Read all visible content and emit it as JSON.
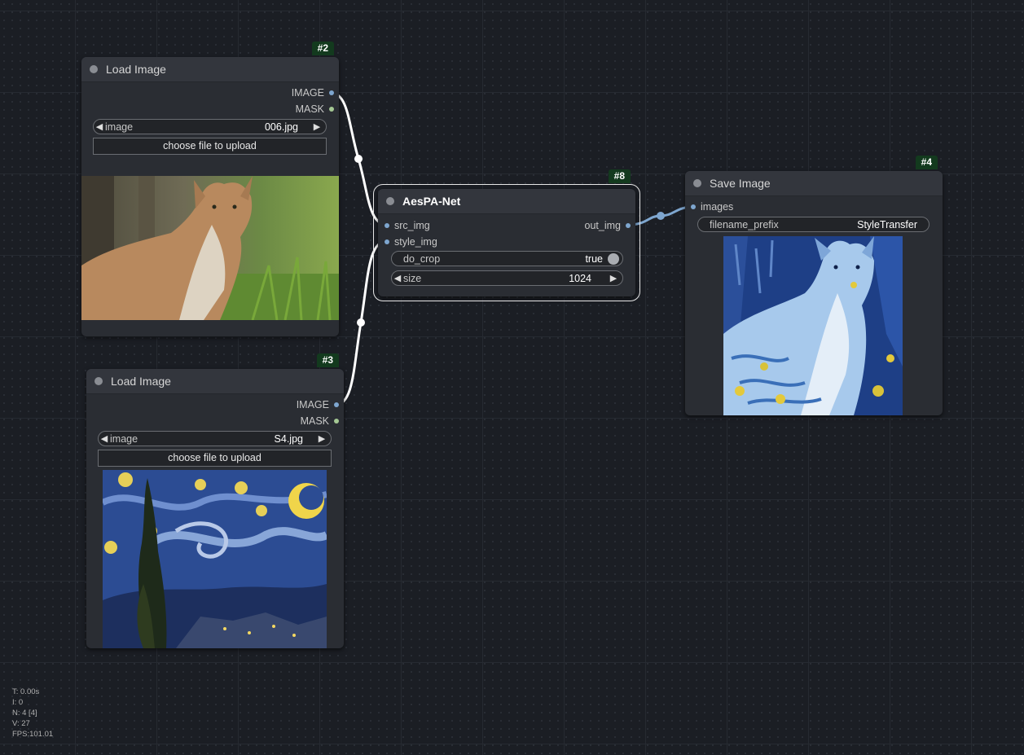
{
  "nodes": {
    "load_image_1": {
      "id_badge": "#2",
      "title": "Load Image",
      "outputs": [
        "IMAGE",
        "MASK"
      ],
      "image_widget": {
        "label": "image",
        "value": "006.jpg"
      },
      "upload_label": "choose file to upload",
      "preview": "photo of a lynx sitting in grass"
    },
    "load_image_2": {
      "id_badge": "#3",
      "title": "Load Image",
      "outputs": [
        "IMAGE",
        "MASK"
      ],
      "image_widget": {
        "label": "image",
        "value": "S4.jpg"
      },
      "upload_label": "choose file to upload",
      "preview": "Starry Night painting"
    },
    "aespa_net": {
      "id_badge": "#8",
      "title": "AesPA-Net",
      "inputs": [
        "src_img",
        "style_img"
      ],
      "outputs": [
        "out_img"
      ],
      "do_crop": {
        "label": "do_crop",
        "value": "true"
      },
      "size": {
        "label": "size",
        "value": "1024"
      }
    },
    "save_image": {
      "id_badge": "#4",
      "title": "Save Image",
      "inputs": [
        "images"
      ],
      "filename_prefix": {
        "label": "filename_prefix",
        "value": "StyleTransfer"
      },
      "preview": "stylized lynx in blue and yellow brush strokes"
    }
  },
  "stats": {
    "t": "T: 0.00s",
    "i": "I: 0",
    "n": "N: 4 [4]",
    "v": "V: 27",
    "fps": "FPS:101.01"
  },
  "colors": {
    "image_slot": "#7ea6cf",
    "mask_slot": "#a5c894",
    "badge_bg": "#133a1e",
    "link_white": "#ffffff",
    "link_blue": "#7ea6cf"
  }
}
